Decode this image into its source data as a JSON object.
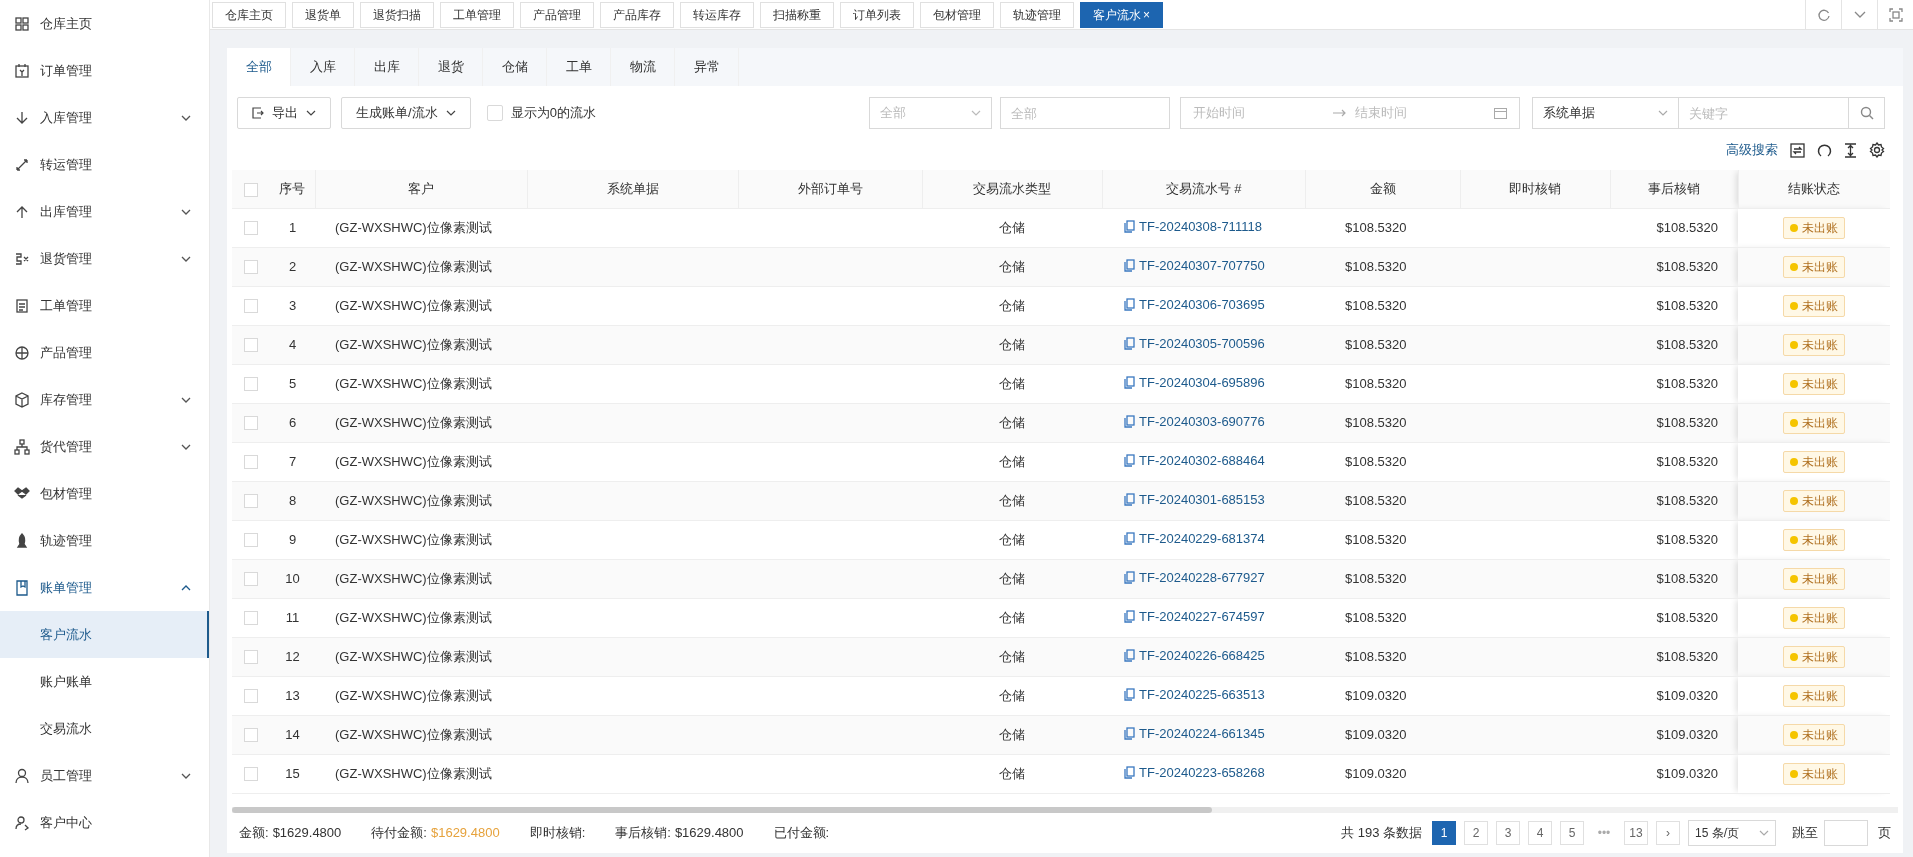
{
  "sidebar": {
    "items": [
      {
        "label": "仓库主页",
        "has_children": false,
        "expanded": false
      },
      {
        "label": "订单管理",
        "has_children": false,
        "expanded": false
      },
      {
        "label": "入库管理",
        "has_children": true,
        "expanded": false
      },
      {
        "label": "转运管理",
        "has_children": false,
        "expanded": false
      },
      {
        "label": "出库管理",
        "has_children": true,
        "expanded": false
      },
      {
        "label": "退货管理",
        "has_children": true,
        "expanded": false
      },
      {
        "label": "工单管理",
        "has_children": false,
        "expanded": false
      },
      {
        "label": "产品管理",
        "has_children": false,
        "expanded": false
      },
      {
        "label": "库存管理",
        "has_children": true,
        "expanded": false
      },
      {
        "label": "货代管理",
        "has_children": true,
        "expanded": false
      },
      {
        "label": "包材管理",
        "has_children": false,
        "expanded": false
      },
      {
        "label": "轨迹管理",
        "has_children": false,
        "expanded": false
      },
      {
        "label": "账单管理",
        "has_children": true,
        "expanded": true,
        "children": [
          {
            "label": "客户流水",
            "selected": true
          },
          {
            "label": "账户账单",
            "selected": false
          },
          {
            "label": "交易流水",
            "selected": false
          }
        ]
      },
      {
        "label": "员工管理",
        "has_children": true,
        "expanded": false
      },
      {
        "label": "客户中心",
        "has_children": false,
        "expanded": false
      }
    ]
  },
  "page_tabs": [
    {
      "label": "仓库主页",
      "selected": false
    },
    {
      "label": "退货单",
      "selected": false
    },
    {
      "label": "退货扫描",
      "selected": false
    },
    {
      "label": "工单管理",
      "selected": false
    },
    {
      "label": "产品管理",
      "selected": false
    },
    {
      "label": "产品库存",
      "selected": false
    },
    {
      "label": "转运库存",
      "selected": false
    },
    {
      "label": "扫描称重",
      "selected": false
    },
    {
      "label": "订单列表",
      "selected": false
    },
    {
      "label": "包材管理",
      "selected": false
    },
    {
      "label": "轨迹管理",
      "selected": false
    },
    {
      "label": "客户流水",
      "selected": true,
      "close": "×"
    }
  ],
  "type_tabs": [
    {
      "label": "全部",
      "selected": true
    },
    {
      "label": "入库",
      "selected": false
    },
    {
      "label": "出库",
      "selected": false
    },
    {
      "label": "退货",
      "selected": false
    },
    {
      "label": "仓储",
      "selected": false
    },
    {
      "label": "工单",
      "selected": false
    },
    {
      "label": "物流",
      "selected": false
    },
    {
      "label": "异常",
      "selected": false
    }
  ],
  "toolbar": {
    "export": "导出",
    "generate": "生成账单/流水",
    "show_zero": {
      "label": "显示为0的流水",
      "checked": false
    },
    "filter_select": {
      "placeholder": "全部"
    },
    "filter_input": {
      "placeholder": "全部"
    },
    "start_date": {
      "placeholder": "开始时间"
    },
    "end_date": {
      "placeholder": "结束时间"
    },
    "field_select": {
      "value": "系统单据"
    },
    "keyword": {
      "placeholder": "关键字"
    },
    "advanced_search": "高级搜索"
  },
  "table": {
    "select_all_checked": false,
    "columns": [
      "序号",
      "客户",
      "系统单据",
      "外部订单号",
      "交易流水类型",
      "交易流水号 #",
      "金额",
      "即时核销",
      "事后核销",
      "结账状态"
    ],
    "rows": [
      {
        "no": "1",
        "customer": "(GZ-WXSHWC)位像素测试",
        "type": "仓储",
        "serial": "TF-20240308-711118",
        "amount": "$108.5320",
        "post": "$108.5320",
        "status": "未出账",
        "checked": false
      },
      {
        "no": "2",
        "customer": "(GZ-WXSHWC)位像素测试",
        "type": "仓储",
        "serial": "TF-20240307-707750",
        "amount": "$108.5320",
        "post": "$108.5320",
        "status": "未出账",
        "checked": false
      },
      {
        "no": "3",
        "customer": "(GZ-WXSHWC)位像素测试",
        "type": "仓储",
        "serial": "TF-20240306-703695",
        "amount": "$108.5320",
        "post": "$108.5320",
        "status": "未出账",
        "checked": false
      },
      {
        "no": "4",
        "customer": "(GZ-WXSHWC)位像素测试",
        "type": "仓储",
        "serial": "TF-20240305-700596",
        "amount": "$108.5320",
        "post": "$108.5320",
        "status": "未出账",
        "checked": false
      },
      {
        "no": "5",
        "customer": "(GZ-WXSHWC)位像素测试",
        "type": "仓储",
        "serial": "TF-20240304-695896",
        "amount": "$108.5320",
        "post": "$108.5320",
        "status": "未出账",
        "checked": false
      },
      {
        "no": "6",
        "customer": "(GZ-WXSHWC)位像素测试",
        "type": "仓储",
        "serial": "TF-20240303-690776",
        "amount": "$108.5320",
        "post": "$108.5320",
        "status": "未出账",
        "checked": false
      },
      {
        "no": "7",
        "customer": "(GZ-WXSHWC)位像素测试",
        "type": "仓储",
        "serial": "TF-20240302-688464",
        "amount": "$108.5320",
        "post": "$108.5320",
        "status": "未出账",
        "checked": false
      },
      {
        "no": "8",
        "customer": "(GZ-WXSHWC)位像素测试",
        "type": "仓储",
        "serial": "TF-20240301-685153",
        "amount": "$108.5320",
        "post": "$108.5320",
        "status": "未出账",
        "checked": false
      },
      {
        "no": "9",
        "customer": "(GZ-WXSHWC)位像素测试",
        "type": "仓储",
        "serial": "TF-20240229-681374",
        "amount": "$108.5320",
        "post": "$108.5320",
        "status": "未出账",
        "checked": false
      },
      {
        "no": "10",
        "customer": "(GZ-WXSHWC)位像素测试",
        "type": "仓储",
        "serial": "TF-20240228-677927",
        "amount": "$108.5320",
        "post": "$108.5320",
        "status": "未出账",
        "checked": false
      },
      {
        "no": "11",
        "customer": "(GZ-WXSHWC)位像素测试",
        "type": "仓储",
        "serial": "TF-20240227-674597",
        "amount": "$108.5320",
        "post": "$108.5320",
        "status": "未出账",
        "checked": false
      },
      {
        "no": "12",
        "customer": "(GZ-WXSHWC)位像素测试",
        "type": "仓储",
        "serial": "TF-20240226-668425",
        "amount": "$108.5320",
        "post": "$108.5320",
        "status": "未出账",
        "checked": false
      },
      {
        "no": "13",
        "customer": "(GZ-WXSHWC)位像素测试",
        "type": "仓储",
        "serial": "TF-20240225-663513",
        "amount": "$109.0320",
        "post": "$109.0320",
        "status": "未出账",
        "checked": false
      },
      {
        "no": "14",
        "customer": "(GZ-WXSHWC)位像素测试",
        "type": "仓储",
        "serial": "TF-20240224-661345",
        "amount": "$109.0320",
        "post": "$109.0320",
        "status": "未出账",
        "checked": false
      },
      {
        "no": "15",
        "customer": "(GZ-WXSHWC)位像素测试",
        "type": "仓储",
        "serial": "TF-20240223-658268",
        "amount": "$109.0320",
        "post": "$109.0320",
        "status": "未出账",
        "checked": false
      }
    ]
  },
  "summary": [
    {
      "label": "金额:",
      "value": "$1629.4800"
    },
    {
      "label": "待付金额:",
      "value": "$1629.4800",
      "highlight": true
    },
    {
      "label": "即时核销:"
    },
    {
      "label": "事后核销:",
      "value": "$1629.4800"
    },
    {
      "label": "已付金额:"
    }
  ],
  "pagination": {
    "total": "共 193 条数据",
    "pages": [
      {
        "label": "1",
        "selected": true
      },
      {
        "label": "2",
        "selected": false
      },
      {
        "label": "3",
        "selected": false
      },
      {
        "label": "4",
        "selected": false
      },
      {
        "label": "5",
        "selected": false
      }
    ],
    "ellipsis": "•••",
    "last": "13",
    "next": "›",
    "page_size": "15 条/页",
    "jump_label": "跳至",
    "jump_suffix": "页"
  }
}
